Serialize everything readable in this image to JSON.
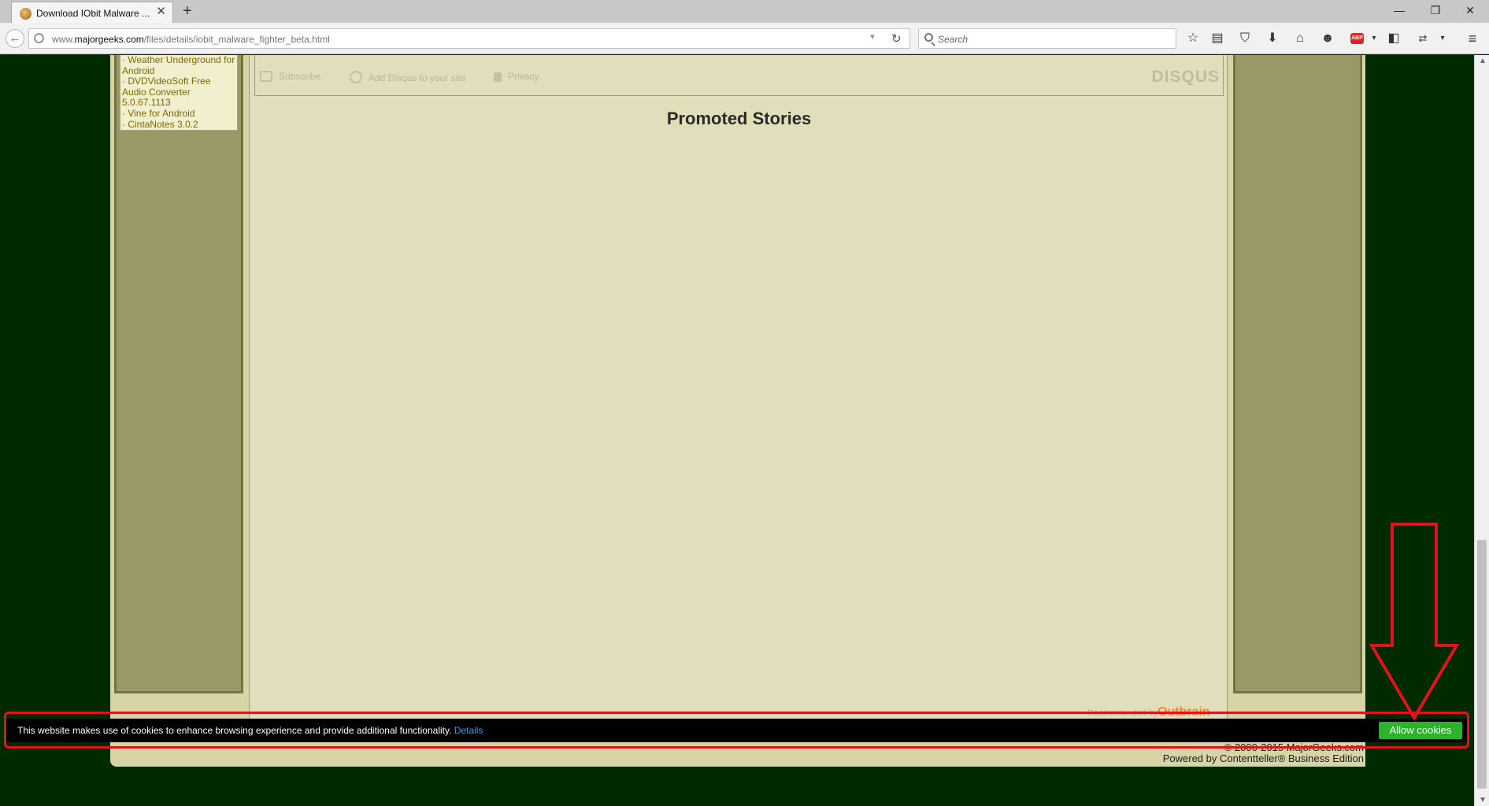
{
  "browser": {
    "tab_title": "Download IObit Malware ...",
    "tab_close": "✕",
    "new_tab": "+",
    "url_prefix": "www.",
    "url_host": "majorgeeks.com",
    "url_path": "/files/details/iobit_malware_fighter_beta.html",
    "search_placeholder": "Search",
    "window_controls": [
      "—",
      "❐",
      "✕"
    ],
    "toolbar_icons": [
      "star-icon",
      "reading-list-icon",
      "pocket-icon",
      "download-icon",
      "home-icon",
      "chat-icon",
      "adblock-icon",
      "screenshot-icon",
      "sync-icon",
      "menu-icon"
    ],
    "abp_label": "ABP"
  },
  "sidebar": {
    "items": [
      "· Weather Underground for Android",
      "· DVDVideoSoft Free Audio Converter 5.0.67.1113",
      "· Vine for Android",
      "· CintaNotes 3.0.2"
    ]
  },
  "disqus": {
    "subscribe": "Subscribe",
    "add_disqus": "Add Disqus to your site",
    "privacy": "Privacy",
    "logo": "DISQUS"
  },
  "promoted": {
    "title": "Promoted Stories",
    "recommended_by": "Recommended by",
    "outbrain": "Outbrain"
  },
  "footer": {
    "copyright": "© 2000-2015 MajorGeeks.com",
    "powered": "Powered by Contentteller® Business Edition"
  },
  "cookie": {
    "message": "This website makes use of cookies to enhance browsing experience and provide additional functionality.",
    "details": "Details",
    "allow": "Allow cookies"
  },
  "colors": {
    "page_bg": "#002b00",
    "site_bg": "#d7d5a8",
    "column": "#999967",
    "panel": "#e1dfbb",
    "link": "#7a6a00",
    "cookie_button": "#2bb32b",
    "annotation": "#e3131b"
  }
}
